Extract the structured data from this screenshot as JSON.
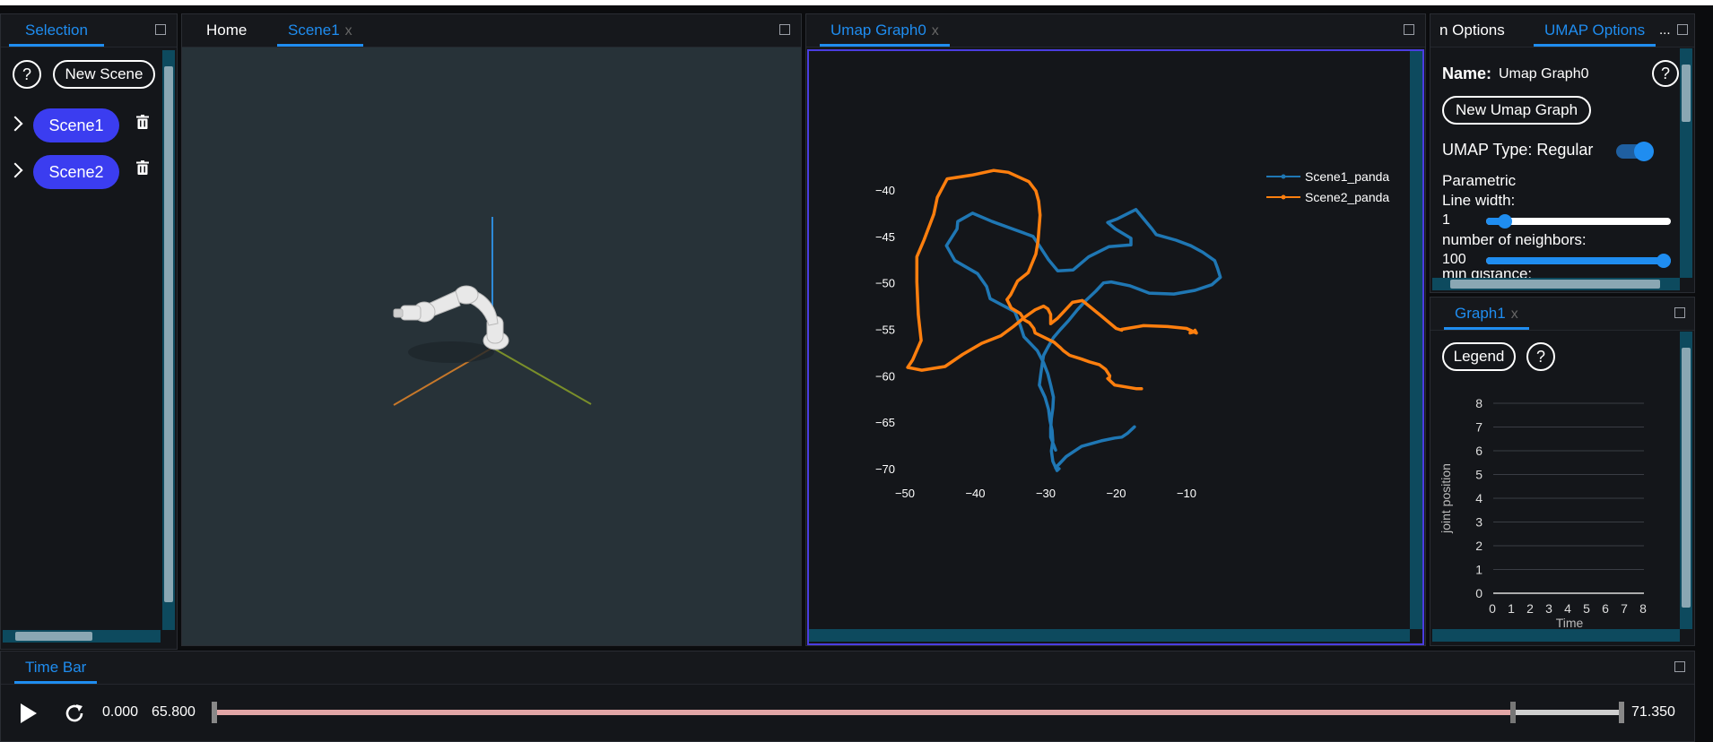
{
  "selection_panel": {
    "tab": "Selection",
    "help_label": "?",
    "new_scene_label": "New Scene",
    "scenes": [
      {
        "label": "Scene1"
      },
      {
        "label": "Scene2"
      }
    ]
  },
  "viewport_panel": {
    "tabs": [
      {
        "label": "Home"
      },
      {
        "label": "Scene1",
        "close": "x"
      }
    ]
  },
  "umap_panel": {
    "tab": "Umap Graph0",
    "close": "x"
  },
  "options_panel": {
    "tabs": [
      {
        "label": "n Options"
      },
      {
        "label": "UMAP Options"
      }
    ],
    "more": "...",
    "name_label": "Name:",
    "name_value": "Umap Graph0",
    "help_label": "?",
    "new_graph_label": "New Umap Graph",
    "type_label": "UMAP Type: Regular",
    "type_toggle_on": true,
    "parametric_label": "Parametric",
    "line_width_label": "Line width:",
    "line_width_value": "1",
    "line_width_fraction": 0.1,
    "neighbors_label": "number of neighbors:",
    "neighbors_value": "100",
    "neighbors_fraction": 1.0,
    "partial_label": "min distance:"
  },
  "graph1_panel": {
    "tab": "Graph1",
    "close": "x",
    "legend_label": "Legend",
    "help_label": "?"
  },
  "timebar": {
    "tab": "Time Bar",
    "start_time": "0.000",
    "current_time": "65.800",
    "end_time": "71.350",
    "current_fraction": 0.922
  },
  "colors": {
    "accent": "#1f8df0",
    "scene_button": "#3b3df0",
    "series1": "#1f77b4",
    "series2": "#ff7f0e"
  },
  "chart_data": [
    {
      "type": "line",
      "title": "",
      "xlabel": "",
      "ylabel": "",
      "xlim": [
        -52,
        -5
      ],
      "ylim": [
        -71,
        -38
      ],
      "xticks": [
        -50,
        -40,
        -30,
        -20,
        -10
      ],
      "yticks": [
        -40,
        -45,
        -50,
        -55,
        -60,
        -65,
        -70
      ],
      "tick_labels_x": [
        "−50",
        "−40",
        "−30",
        "−20",
        "−10"
      ],
      "tick_labels_y": [
        "−40",
        "−45",
        "−50",
        "−55",
        "−60",
        "−65",
        "−70"
      ],
      "legend_position": "top-right",
      "series": [
        {
          "name": "Scene1_panda",
          "x": [
            -28.6,
            -29.3,
            -29.3,
            -29.2,
            -29.0,
            -28.9,
            -29.3,
            -29.7,
            -30.3,
            -31.2,
            -33.1,
            -33.6,
            -34.4,
            -37.9,
            -38.4,
            -39.7,
            -42.9,
            -44.1,
            -42.6,
            -42.5,
            -40.4,
            -37.6,
            -31.8,
            -30.9,
            -29.6,
            -28.3,
            -26.1,
            -23.9,
            -21.0,
            -17.9,
            -17.9,
            -20.1,
            -21.2,
            -19.8,
            -17.2,
            -14.9,
            -14.3,
            -11.5,
            -9.4,
            -7.7,
            -6.0,
            -5.6,
            -5.2,
            -6.4,
            -8.8,
            -11.8,
            -15.3,
            -18.1,
            -20.7,
            -21.8,
            -22.9,
            -24.3,
            -25.5,
            -26.8,
            -27.9,
            -28.9,
            -29.6,
            -30.3,
            -30.5,
            -30.7,
            -30.9,
            -30.1,
            -29.6,
            -29.4,
            -29.1,
            -29.0,
            -29.2,
            -29.0,
            -28.4,
            -28.1,
            -28.1,
            -28.6,
            -27.1,
            -24.9,
            -22.1,
            -20.2,
            -19.2,
            -18.4,
            -17.4
          ],
          "y": [
            -68.0,
            -66.6,
            -65.7,
            -64.6,
            -63.5,
            -62.3,
            -61.0,
            -59.8,
            -58.6,
            -57.3,
            -55.8,
            -54.6,
            -53.1,
            -51.7,
            -50.4,
            -49.0,
            -47.6,
            -46.0,
            -44.2,
            -43.4,
            -42.5,
            -43.4,
            -45.0,
            -46.0,
            -47.5,
            -48.7,
            -48.6,
            -47.2,
            -46.1,
            -45.9,
            -45.2,
            -44.2,
            -43.5,
            -43.1,
            -42.1,
            -44.2,
            -44.8,
            -45.4,
            -46.0,
            -46.7,
            -47.6,
            -48.4,
            -49.4,
            -50.2,
            -50.8,
            -51.2,
            -51.1,
            -50.3,
            -49.9,
            -50.0,
            -50.9,
            -51.9,
            -52.9,
            -54.1,
            -55.0,
            -55.9,
            -56.8,
            -57.8,
            -58.7,
            -59.8,
            -61.0,
            -62.3,
            -63.6,
            -64.8,
            -65.9,
            -67.0,
            -68.1,
            -69.2,
            -70.2,
            -70.0,
            -70.0,
            -69.9,
            -68.7,
            -67.6,
            -67.0,
            -66.7,
            -66.6,
            -66.2,
            -65.5
          ]
        },
        {
          "name": "Scene2_panda",
          "x": [
            -16.4,
            -17.1,
            -20.2,
            -21.2,
            -21.0,
            -20.9,
            -21.5,
            -22.4,
            -23.8,
            -24.9,
            -26.6,
            -27.5,
            -27.9,
            -28.8,
            -30.4,
            -31.5,
            -31.7,
            -32.3,
            -33.0,
            -33.1,
            -33.6,
            -34.9,
            -35.5,
            -35.0,
            -34.0,
            -32.5,
            -31.4,
            -31.1,
            -30.8,
            -31.0,
            -31.4,
            -32.4,
            -35.3,
            -37.4,
            -40.5,
            -44.0,
            -45.4,
            -45.9,
            -47.3,
            -48.3,
            -48.3,
            -48.1,
            -47.7,
            -48.9,
            -49.6,
            -47.6,
            -44.3,
            -41.8,
            -39.1,
            -36.4,
            -34.6,
            -33.0,
            -31.5,
            -30.3,
            -29.7,
            -29.3,
            -29.3,
            -28.3,
            -26.2,
            -24.8,
            -22.2,
            -20.0,
            -19.2,
            -19.2,
            -16.1,
            -12.7,
            -10.0,
            -8.6,
            -8.8,
            -9.0,
            -9.5
          ],
          "y": [
            -61.4,
            -61.4,
            -61.0,
            -60.3,
            -60.4,
            -60.0,
            -59.3,
            -58.8,
            -58.5,
            -58.2,
            -57.8,
            -57.3,
            -57.0,
            -56.4,
            -55.8,
            -55.4,
            -54.9,
            -54.3,
            -54.0,
            -53.9,
            -53.3,
            -52.7,
            -51.8,
            -51.3,
            -49.8,
            -48.9,
            -46.9,
            -45.5,
            -42.7,
            -41.2,
            -40.1,
            -39.1,
            -38.1,
            -37.9,
            -38.4,
            -38.8,
            -40.8,
            -42.6,
            -45.4,
            -47.2,
            -49.9,
            -53.4,
            -56.2,
            -58.3,
            -59.1,
            -59.4,
            -59.0,
            -57.7,
            -56.5,
            -55.7,
            -54.7,
            -53.7,
            -52.9,
            -52.5,
            -52.8,
            -53.4,
            -54.4,
            -53.8,
            -52.1,
            -51.9,
            -53.5,
            -54.9,
            -55.1,
            -55.0,
            -54.6,
            -54.7,
            -54.9,
            -55.4,
            -55.1,
            -55.3,
            -55.4
          ]
        }
      ]
    },
    {
      "type": "line",
      "title": "",
      "xlabel": "Time",
      "ylabel": "joint position",
      "xlim": [
        0,
        8
      ],
      "ylim": [
        0,
        8
      ],
      "xticks": [
        0,
        1,
        2,
        3,
        4,
        5,
        6,
        7,
        8
      ],
      "yticks": [
        0,
        1,
        2,
        3,
        4,
        5,
        6,
        7,
        8
      ],
      "grid": true,
      "series": []
    }
  ]
}
